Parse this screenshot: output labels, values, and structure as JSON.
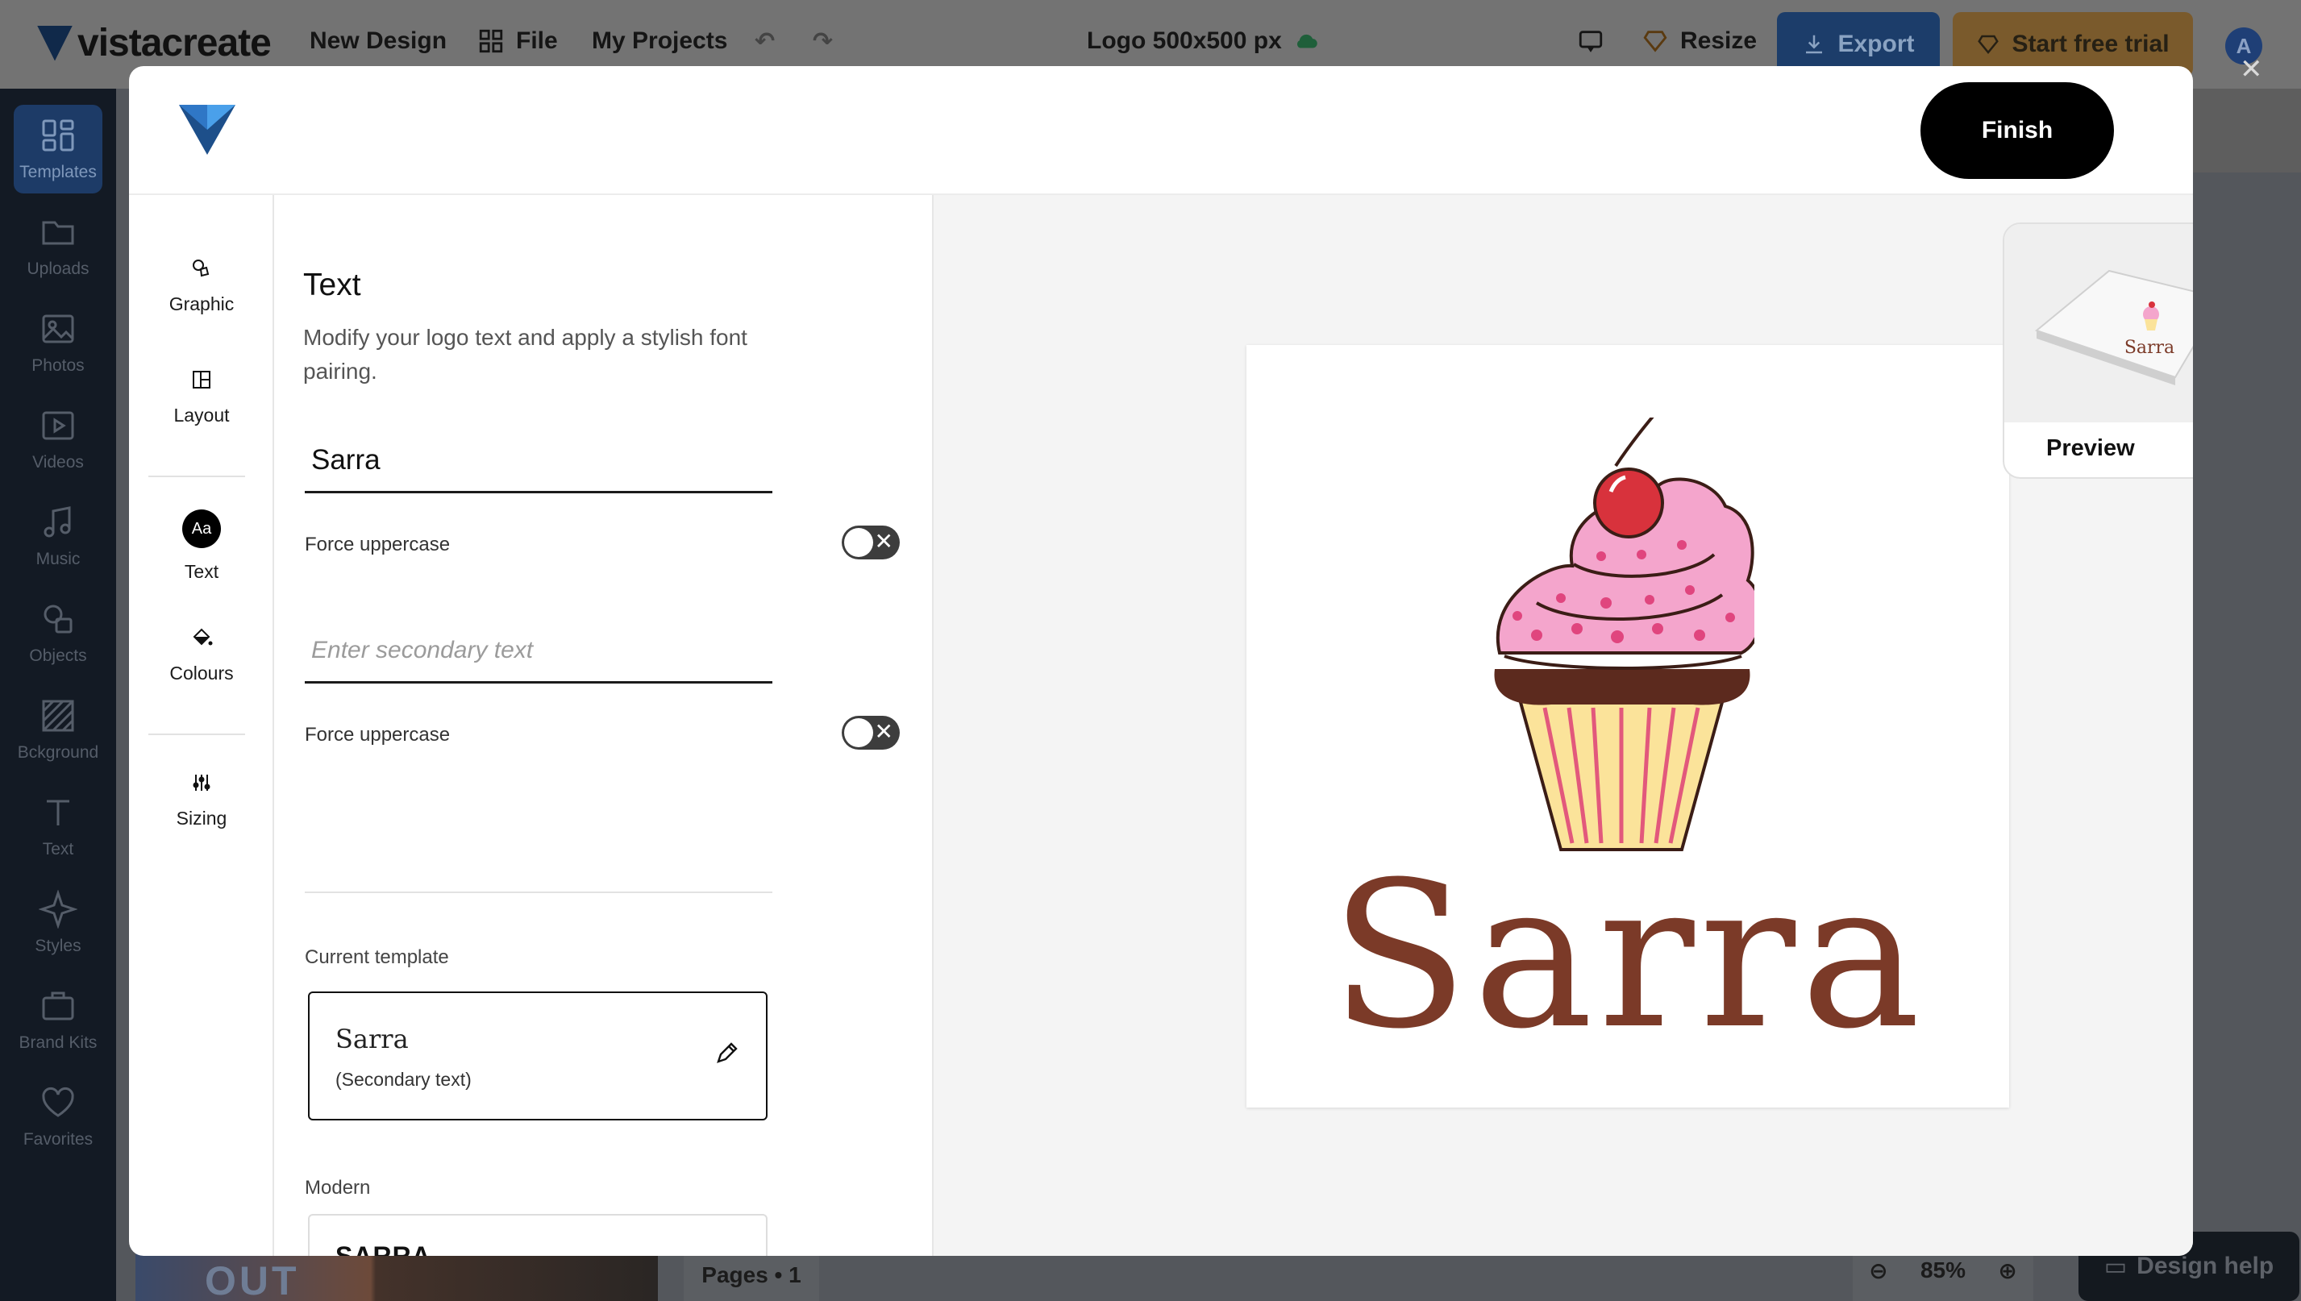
{
  "app": {
    "brand": "vistacreate",
    "menu": {
      "new_design": "New Design",
      "file": "File",
      "my_projects": "My Projects"
    },
    "doc_title": "Logo 500x500 px",
    "resize": "Resize",
    "export": "Export",
    "trial": "Start free trial",
    "avatar_letter": "A"
  },
  "sidebar": {
    "items": [
      {
        "label": "Templates",
        "icon": "templates-icon"
      },
      {
        "label": "Uploads",
        "icon": "folder-icon"
      },
      {
        "label": "Photos",
        "icon": "image-icon"
      },
      {
        "label": "Videos",
        "icon": "video-icon"
      },
      {
        "label": "Music",
        "icon": "music-icon"
      },
      {
        "label": "Objects",
        "icon": "shapes-icon"
      },
      {
        "label": "Bckground",
        "icon": "background-icon"
      },
      {
        "label": "Text",
        "icon": "text-icon"
      },
      {
        "label": "Styles",
        "icon": "sparkle-icon"
      },
      {
        "label": "Brand Kits",
        "icon": "briefcase-icon"
      },
      {
        "label": "Favorites",
        "icon": "heart-icon"
      }
    ]
  },
  "background": {
    "thumb_text": "OUT",
    "pages": "Pages • 1",
    "zoom": "85%",
    "help": "Design help"
  },
  "modal": {
    "finish": "Finish",
    "tools": {
      "graphic": "Graphic",
      "layout": "Layout",
      "text": "Text",
      "text_badge": "Aa",
      "colours": "Colours",
      "sizing": "Sizing"
    },
    "panel": {
      "title": "Text",
      "description": "Modify your logo text and apply a stylish font pairing.",
      "primary_text": "Sarra",
      "force_uppercase_1": "Force uppercase",
      "secondary_placeholder": "Enter secondary text",
      "force_uppercase_2": "Force uppercase",
      "current_template_label": "Current template",
      "current_template_main": "Sarra",
      "current_template_sub": "(Secondary text)",
      "modern_label": "Modern",
      "modern_sample": "SARRA"
    },
    "canvas": {
      "logo_text": "Sarra",
      "preview_label": "Preview",
      "preview_arrow": "→",
      "preview_card_text": "Sarra"
    },
    "colors": {
      "logo_text": "#7b3a28",
      "frosting": "#f4a5cc",
      "cherry": "#d8323c",
      "wrapper": "#fbe39a"
    }
  }
}
